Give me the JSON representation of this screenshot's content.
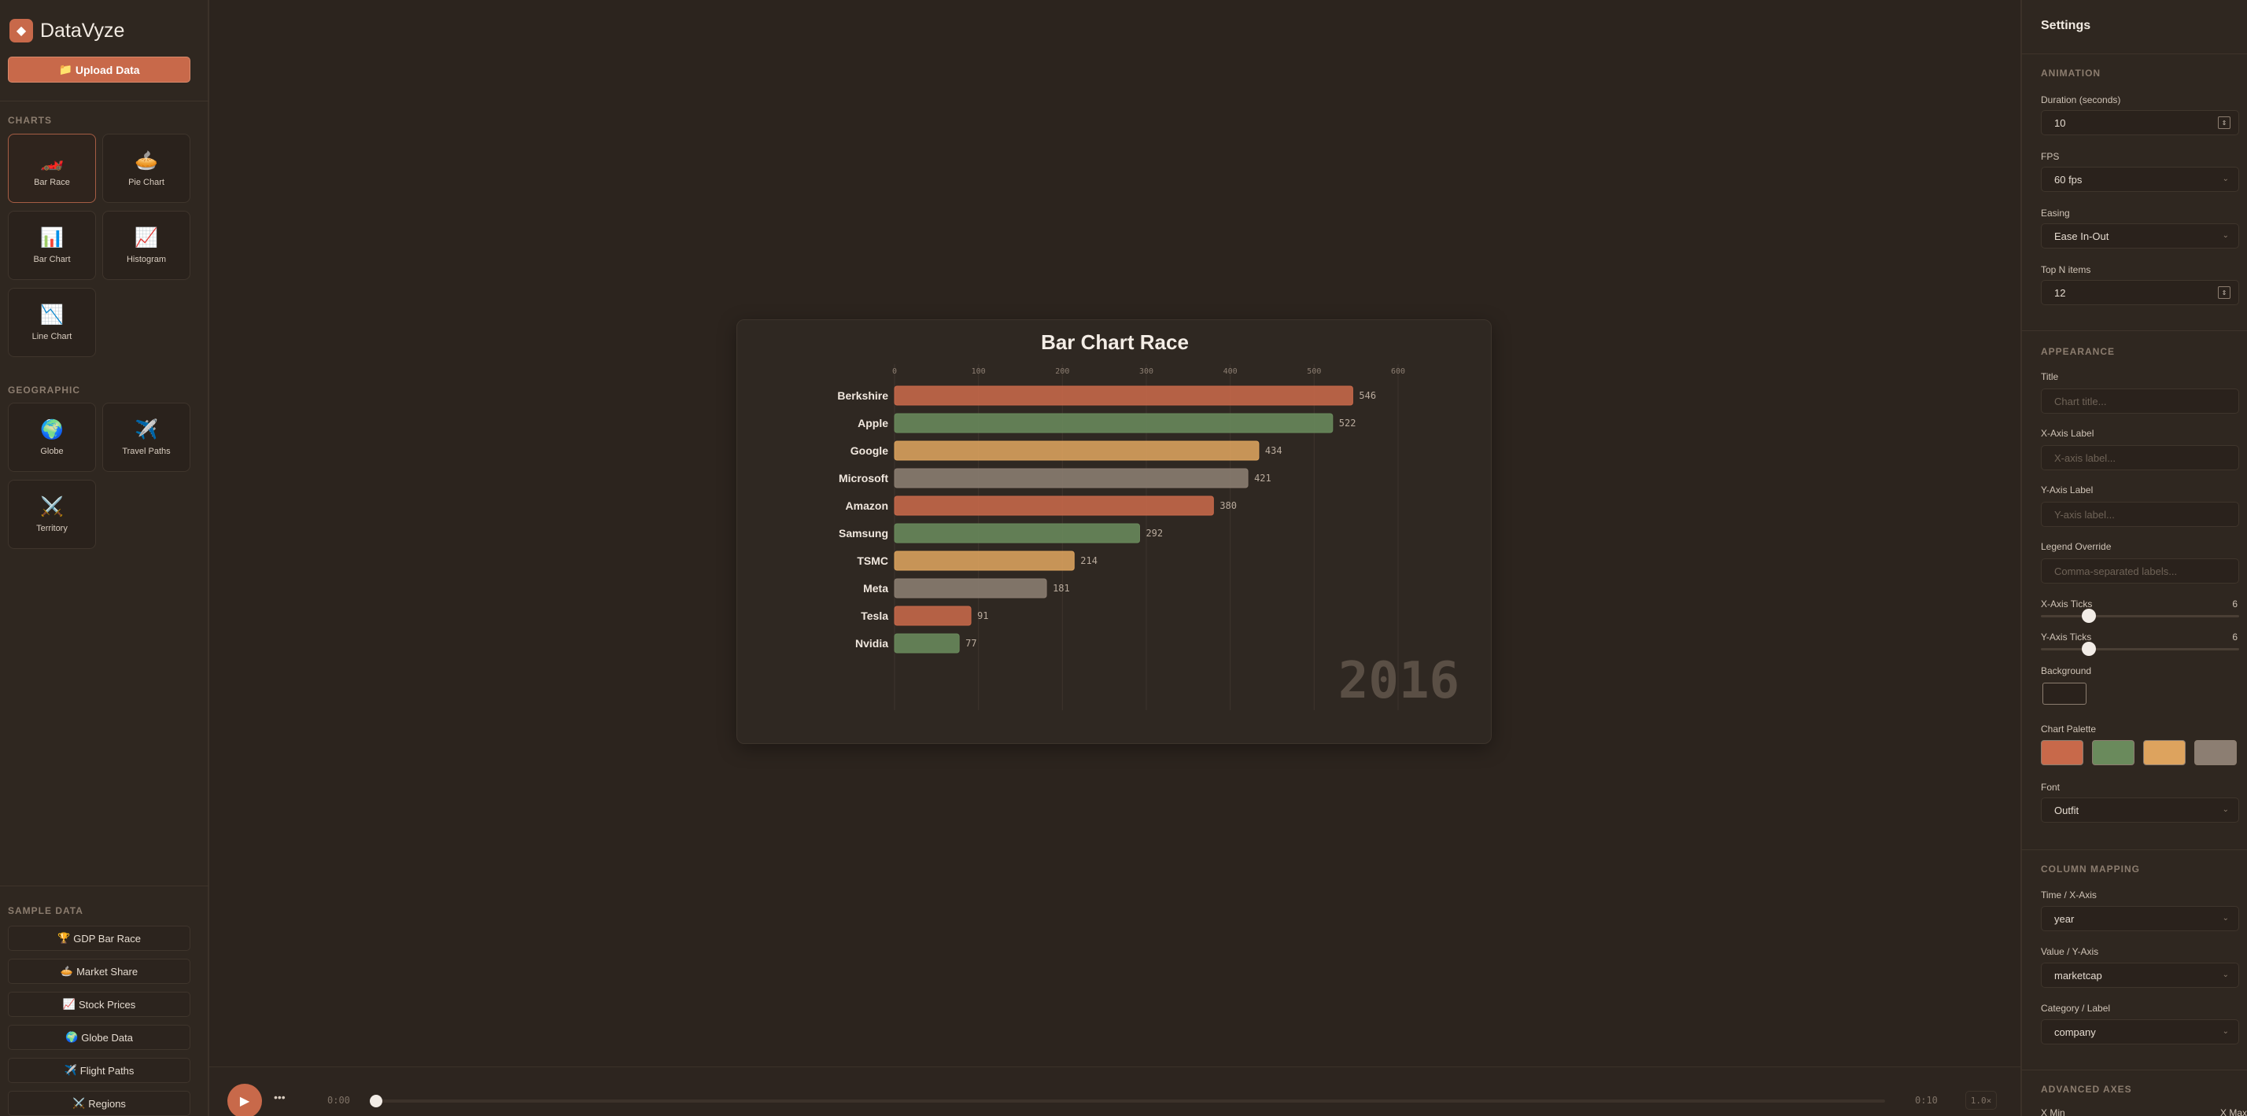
{
  "app": {
    "name": "DataVyze",
    "logo_glyph": "◆",
    "upload_label": "Upload Data",
    "upload_icon": "📁"
  },
  "sidebar": {
    "charts_heading": "CHARTS",
    "chart_types": [
      {
        "label": "Bar Race",
        "icon": "🏎️",
        "icon_name": "race-car-icon"
      },
      {
        "label": "Pie Chart",
        "icon": "🥧",
        "icon_name": "pie-icon"
      },
      {
        "label": "Bar Chart",
        "icon": "📊",
        "icon_name": "bar-chart-icon"
      },
      {
        "label": "Histogram",
        "icon": "📈",
        "icon_name": "trend-up-icon"
      },
      {
        "label": "Line Chart",
        "icon": "📉",
        "icon_name": "trend-down-icon"
      }
    ],
    "geo_heading": "GEOGRAPHIC",
    "geo_types": [
      {
        "label": "Globe",
        "icon": "🌍",
        "icon_name": "globe-icon"
      },
      {
        "label": "Travel Paths",
        "icon": "✈️",
        "icon_name": "airplane-icon"
      },
      {
        "label": "Territory",
        "icon": "⚔️",
        "icon_name": "swords-icon"
      }
    ],
    "sample_heading": "SAMPLE DATA",
    "samples": [
      {
        "label": "GDP Bar Race",
        "icon": "🏆"
      },
      {
        "label": "Market Share",
        "icon": "🥧"
      },
      {
        "label": "Stock Prices",
        "icon": "📈"
      },
      {
        "label": "Globe Data",
        "icon": "🌍"
      },
      {
        "label": "Flight Paths",
        "icon": "✈️"
      },
      {
        "label": "Regions",
        "icon": "⚔️"
      }
    ]
  },
  "chart_data": {
    "type": "bar",
    "title": "Bar Chart Race",
    "period_label": "2016",
    "categories": [
      "Berkshire",
      "Apple",
      "Google",
      "Microsoft",
      "Amazon",
      "Samsung",
      "TSMC",
      "Meta",
      "Tesla",
      "Nvidia"
    ],
    "values": [
      546,
      522,
      434,
      421,
      380,
      292,
      214,
      181,
      91,
      77
    ],
    "ticks": [
      0,
      100,
      200,
      300,
      400,
      500,
      600
    ],
    "xlim": [
      0,
      600
    ],
    "grid": true,
    "palette": [
      "#c8694a",
      "#6a8a5c",
      "#dda35e",
      "#8c7e72"
    ]
  },
  "playback": {
    "play_icon": "▶",
    "more_icon": "•••",
    "current_time": "0:00",
    "end_time": "0:10",
    "speed": "1.0×",
    "progress": 0
  },
  "settings": {
    "title": "Settings",
    "animation_heading": "ANIMATION",
    "duration_label": "Duration (seconds)",
    "duration_value": "10",
    "fps_label": "FPS",
    "fps_value": "60 fps",
    "easing_label": "Easing",
    "easing_value": "Ease In-Out",
    "topn_label": "Top N items",
    "topn_value": "12",
    "appearance_heading": "APPEARANCE",
    "title_label": "Title",
    "title_placeholder": "Chart title...",
    "xaxis_label": "X-Axis Label",
    "xaxis_placeholder": "X-axis label...",
    "yaxis_label": "Y-Axis Label",
    "yaxis_placeholder": "Y-axis label...",
    "legend_label": "Legend Override",
    "legend_placeholder": "Comma-separated labels...",
    "xticks_label": "X-Axis Ticks",
    "xticks_value": "6",
    "yticks_label": "Y-Axis Ticks",
    "yticks_value": "6",
    "background_label": "Background",
    "background_color": "#2a221c",
    "palette_label": "Chart Palette",
    "font_label": "Font",
    "font_value": "Outfit",
    "column_heading": "COLUMN MAPPING",
    "time_label": "Time / X-Axis",
    "time_value": "year",
    "value_label": "Value / Y-Axis",
    "value_value": "marketcap",
    "category_label": "Category / Label",
    "category_value": "company",
    "advanced_heading": "ADVANCED AXES",
    "xmin_label": "X Min",
    "xmax_label": "X Max"
  }
}
